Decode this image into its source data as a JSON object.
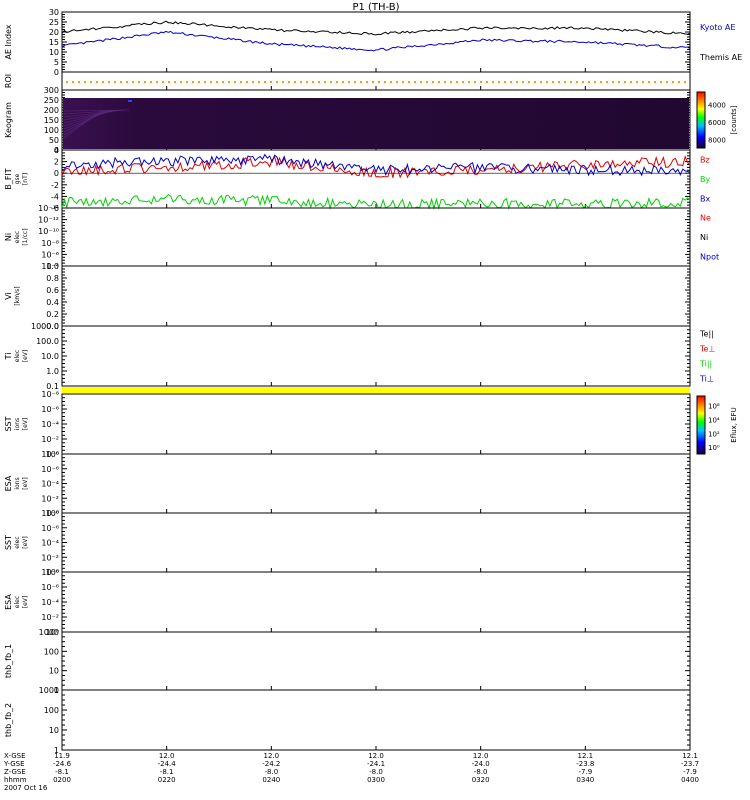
{
  "title": "P1 (TH-B)",
  "colors": {
    "black": "#000000",
    "red": "#e00000",
    "green": "#00d000",
    "blue": "#0000cc",
    "yellow": "#ffff00",
    "orange": "#ff9900"
  },
  "panels": [
    {
      "key": "ae",
      "ylabel": [
        "AE Index"
      ],
      "ticks": [
        "0",
        "5",
        "10",
        "15",
        "20",
        "25",
        "30"
      ],
      "ylim": [
        0,
        30
      ],
      "legend": [
        {
          "label": "Kyoto AE",
          "color": "blue"
        },
        {
          "label": "Themis AE",
          "color": "black"
        }
      ]
    },
    {
      "key": "roi",
      "ylabel": [
        "ROI"
      ]
    },
    {
      "key": "keogram",
      "ylabel": [
        "Keogram"
      ],
      "ticks": [
        "0",
        "50",
        "100",
        "150",
        "200",
        "250",
        "300"
      ],
      "ylim": [
        0,
        300
      ],
      "colorbar": {
        "ticks": [
          "4000",
          "6000",
          "8000"
        ],
        "label": "[counts]"
      }
    },
    {
      "key": "bfield",
      "ylabel": [
        "B_FIT",
        "gse",
        "[nT]"
      ],
      "ticks": [
        "-6",
        "-4",
        "-2",
        "0",
        "2",
        "4"
      ],
      "ylim": [
        -6,
        4
      ],
      "legend": [
        {
          "label": "Bz",
          "color": "red"
        },
        {
          "label": "By",
          "color": "green"
        },
        {
          "label": "Bx",
          "color": "blue"
        }
      ]
    },
    {
      "key": "density",
      "ylabel": [
        "Ni",
        "elec",
        "[1/cc]"
      ],
      "ticks": [
        "10⁻⁴",
        "10⁻⁶",
        "10⁻⁸",
        "10⁻¹⁰",
        "10⁻¹²",
        "10⁻¹⁴"
      ],
      "legend": [
        {
          "label": "Ne",
          "color": "red"
        },
        {
          "label": "Ni",
          "color": "black"
        },
        {
          "label": "Npot",
          "color": "blue"
        }
      ]
    },
    {
      "key": "velocity",
      "ylabel": [
        "Vi",
        "[km/s]"
      ],
      "ticks": [
        "0.0",
        "0.2",
        "0.4",
        "0.6",
        "0.8",
        "1.0"
      ],
      "ylim": [
        0,
        1
      ]
    },
    {
      "key": "temperature",
      "ylabel": [
        "Ti",
        "elec",
        "[eV]"
      ],
      "ticks": [
        "0.1",
        "1.0",
        "10.0",
        "100.0",
        "1000.0"
      ],
      "legend": [
        {
          "label": "Te||",
          "color": "black"
        },
        {
          "label": "Te⊥",
          "color": "red"
        },
        {
          "label": "Ti||",
          "color": "green"
        },
        {
          "label": "Ti⊥",
          "color": "blue"
        }
      ]
    },
    {
      "key": "yellowbar"
    },
    {
      "key": "sst_ion",
      "ylabel": [
        "SST",
        "ions",
        "[eV]"
      ],
      "ticks": [
        "10⁰",
        "10⁻²",
        "10⁻⁴",
        "10⁻⁶",
        "10⁻⁸"
      ],
      "colorbar": {
        "ticks": [
          "10⁸",
          "10⁴",
          "10²",
          "10⁰"
        ],
        "label": "Eflux, EFU"
      }
    },
    {
      "key": "esa_ion",
      "ylabel": [
        "ESA",
        "ions",
        "[eV]"
      ],
      "ticks": [
        "10⁰",
        "10⁻²",
        "10⁻⁴",
        "10⁻⁶",
        "10⁻⁸"
      ]
    },
    {
      "key": "sst_elec",
      "ylabel": [
        "SST",
        "elec",
        "[eV]"
      ],
      "ticks": [
        "10⁰",
        "10⁻²",
        "10⁻⁴",
        "10⁻⁶",
        "10⁻⁸"
      ]
    },
    {
      "key": "esa_elec",
      "ylabel": [
        "ESA",
        "elec",
        "[eV]"
      ],
      "ticks": [
        "10⁰",
        "10⁻²",
        "10⁻⁴",
        "10⁻⁶",
        "10⁻⁸"
      ]
    },
    {
      "key": "fb1",
      "ylabel": [
        "thb_fb_1"
      ],
      "ticks": [
        "1",
        "10",
        "100",
        "1000"
      ]
    },
    {
      "key": "fb2",
      "ylabel": [
        "thb_fb_2"
      ],
      "ticks": [
        "1",
        "10",
        "100",
        "1000"
      ]
    }
  ],
  "xaxis": {
    "row_labels": [
      "X-GSE",
      "Y-GSE",
      "Z-GSE",
      "hhmm",
      "2007 Oct 16"
    ],
    "columns": [
      [
        "11.9",
        "-24.6",
        "-8.1",
        "0200"
      ],
      [
        "12.0",
        "-24.4",
        "-8.1",
        "0220"
      ],
      [
        "12.0",
        "-24.2",
        "-8.0",
        "0240"
      ],
      [
        "12.0",
        "-24.1",
        "-8.0",
        "0300"
      ],
      [
        "12.0",
        "-24.0",
        "-8.0",
        "0320"
      ],
      [
        "12.1",
        "-23.8",
        "-7.9",
        "0340"
      ],
      [
        "12.1",
        "-23.7",
        "-7.9",
        "0400"
      ]
    ]
  },
  "chart_data": [
    {
      "type": "line",
      "title": "AE Index",
      "x": [
        "0200",
        "0220",
        "0240",
        "0300",
        "0320",
        "0340",
        "0400"
      ],
      "series": [
        {
          "name": "Kyoto AE",
          "color": "blue",
          "values": [
            13,
            20,
            14,
            11,
            16,
            15,
            12
          ]
        },
        {
          "name": "Themis AE",
          "color": "black",
          "values": [
            20,
            25,
            21,
            19,
            22,
            22,
            19
          ]
        }
      ],
      "ylim": [
        0,
        30
      ]
    },
    {
      "type": "line",
      "title": "B_FIT gse [nT]",
      "x": [
        "0200",
        "0220",
        "0240",
        "0300",
        "0320",
        "0340",
        "0400"
      ],
      "series": [
        {
          "name": "Bz",
          "color": "red",
          "values": [
            0.5,
            1.0,
            2.0,
            0.0,
            0.5,
            1.5,
            2.0
          ]
        },
        {
          "name": "By",
          "color": "green",
          "values": [
            -5.0,
            -4.5,
            -4.8,
            -5.5,
            -5.2,
            -5.3,
            -5.0
          ]
        },
        {
          "name": "Bx",
          "color": "blue",
          "values": [
            1.5,
            2.0,
            2.5,
            0.5,
            1.0,
            0.5,
            0.5
          ]
        }
      ],
      "ylim": [
        -6,
        4
      ]
    }
  ]
}
